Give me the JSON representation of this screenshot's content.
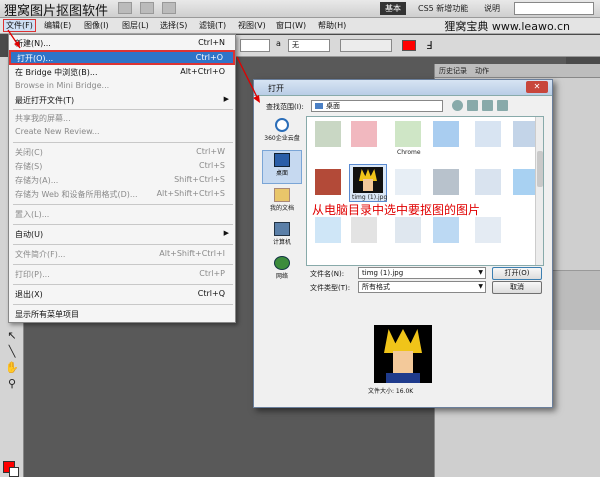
{
  "site": {
    "title": "狸窝图片抠图软件",
    "brand": "狸窝宝典 www.leawo.cn"
  },
  "workspace_switcher": {
    "basic": "基本",
    "cs5_new": "CS5 新增功能",
    "help": "说明"
  },
  "menubar": {
    "items": [
      "文件(F)",
      "编辑(E)",
      "图像(I)",
      "图层(L)",
      "选择(S)",
      "滤镜(T)",
      "视图(V)",
      "窗口(W)",
      "帮助(H)"
    ]
  },
  "options_bar": {
    "aa_label": "a",
    "aa_value": "无"
  },
  "file_menu": {
    "items": [
      {
        "label": "新建(N)...",
        "shortcut": "Ctrl+N",
        "disabled": false
      },
      {
        "label": "打开(O)...",
        "shortcut": "Ctrl+O",
        "disabled": false,
        "highlight": true
      },
      {
        "label": "在 Bridge 中浏览(B)...",
        "shortcut": "Alt+Ctrl+O",
        "disabled": false
      },
      {
        "label": "Browse in Mini Bridge...",
        "shortcut": "",
        "disabled": true
      },
      {
        "label": "最近打开文件(T)",
        "shortcut": "",
        "disabled": false,
        "submenu": true
      },
      {
        "label": "共享我的屏幕...",
        "shortcut": "",
        "disabled": true
      },
      {
        "label": "Create New Review...",
        "shortcut": "",
        "disabled": true
      },
      {
        "label": "关闭(C)",
        "shortcut": "Ctrl+W",
        "disabled": true
      },
      {
        "label": "存储(S)",
        "shortcut": "Ctrl+S",
        "disabled": true
      },
      {
        "label": "存储为(A)...",
        "shortcut": "Shift+Ctrl+S",
        "disabled": true
      },
      {
        "label": "存储为 Web 和设备所用格式(D)...",
        "shortcut": "Alt+Shift+Ctrl+S",
        "disabled": true
      },
      {
        "label": "置入(L)...",
        "shortcut": "",
        "disabled": true
      },
      {
        "label": "自动(U)",
        "shortcut": "",
        "disabled": false,
        "submenu": true
      },
      {
        "label": "文件简介(F)...",
        "shortcut": "Alt+Shift+Ctrl+I",
        "disabled": true
      },
      {
        "label": "打印(P)...",
        "shortcut": "Ctrl+P",
        "disabled": true
      },
      {
        "label": "退出(X)",
        "shortcut": "Ctrl+Q",
        "disabled": false
      },
      {
        "label": "显示所有菜单项目",
        "shortcut": "",
        "disabled": false
      }
    ]
  },
  "panels": {
    "history_tab": "历史记录",
    "actions_tab": "动作"
  },
  "open_dialog": {
    "title": "打开",
    "close_symbol": "✕",
    "look_in_label": "查找范围(I):",
    "look_in_value": "桌面",
    "places": [
      "360企业云盘",
      "桌面",
      "我的文档",
      "计算机",
      "网络"
    ],
    "folder_caption": "Chrome",
    "selected_file": "timg (1).jpg",
    "annotation": "从电脑目录中选中要抠图的图片",
    "filename_label": "文件名(N):",
    "filename_value": "timg (1).jpg",
    "filetype_label": "文件类型(T):",
    "filetype_value": "所有格式",
    "open_button": "打开(O)",
    "cancel_button": "取消",
    "file_size_label": "文件大小: 16.0K"
  },
  "colors": {
    "highlight": "#2f74c8",
    "annotation_red": "#e00000",
    "foreground": "#ff0000"
  }
}
